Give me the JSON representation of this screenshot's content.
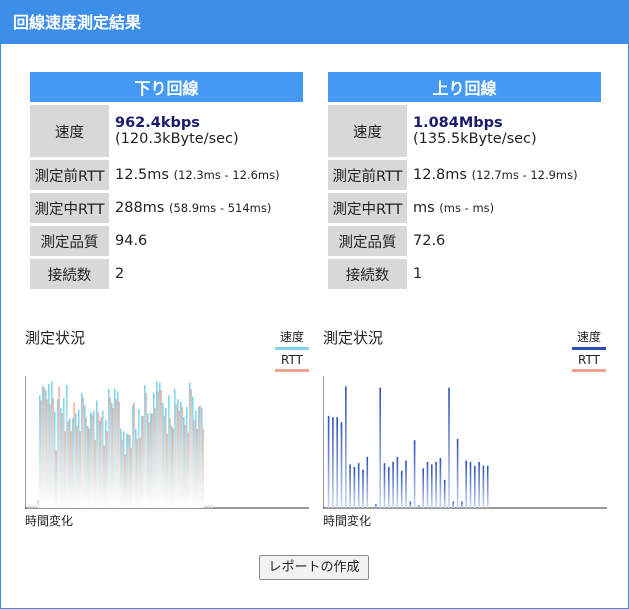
{
  "window": {
    "title": "回線速度測定結果"
  },
  "download": {
    "header": "下り回線",
    "speed_label": "速度",
    "speed_value": "962.4kbps",
    "speed_bytes": "(120.3kByte/sec)",
    "rtt_before_label": "測定前RTT",
    "rtt_before_value": "12.5ms",
    "rtt_before_range": "(12.3ms - 12.6ms)",
    "rtt_during_label": "測定中RTT",
    "rtt_during_value": "288ms",
    "rtt_during_range": "(58.9ms - 514ms)",
    "quality_label": "測定品質",
    "quality_value": "94.6",
    "connections_label": "接続数",
    "connections_value": "2"
  },
  "upload": {
    "header": "上り回線",
    "speed_label": "速度",
    "speed_value": "1.084Mbps",
    "speed_bytes": "(135.5kByte/sec)",
    "rtt_before_label": "測定前RTT",
    "rtt_before_value": "12.8ms",
    "rtt_before_range": "(12.7ms - 12.9ms)",
    "rtt_during_label": "測定中RTT",
    "rtt_during_value": "ms",
    "rtt_during_range": "(ms - ms)",
    "quality_label": "測定品質",
    "quality_value": "72.6",
    "connections_label": "接続数",
    "connections_value": "1"
  },
  "charts": {
    "download": {
      "title": "測定状況",
      "legend_speed": "速度",
      "legend_rtt": "RTT",
      "x_label": "時間変化",
      "speed_color": "#7fd3e8",
      "rtt_color": "#f0a290"
    },
    "upload": {
      "title": "測定状況",
      "legend_speed": "速度",
      "legend_rtt": "RTT",
      "x_label": "時間変化",
      "speed_color": "#2b50b8",
      "rtt_color": "#f0a290"
    }
  },
  "chart_data": [
    {
      "type": "bar",
      "title": "測定状況",
      "xlabel": "時間変化",
      "series": [
        {
          "name": "速度",
          "values": [
            0,
            0,
            0,
            0,
            0.88,
            0.95,
            0.92,
            0.97,
            0.99,
            0.75,
            0.85,
            0.78,
            0.86,
            0.96,
            0.7,
            0.7,
            0.74,
            0.77,
            0.9,
            0.8,
            0.64,
            0.75,
            0.76,
            0.84,
            0.68,
            0.76,
            0.69,
            0.93,
            0.82,
            0.93,
            0.91,
            0.62,
            0.6,
            0.58,
            0.57,
            0.8,
            0.62,
            0.77,
            0.72,
            0.96,
            0.74,
            0.74,
            0.9,
            0.99,
            0.98,
            0.82,
            0.78,
            0.88,
            0.64,
            0.93,
            0.85,
            0.83,
            0.71,
            0.79,
            0.98,
            0.87,
            0.76,
            0.79,
            0.78,
            0,
            0,
            0
          ]
        },
        {
          "name": "RTT",
          "values": [
            0.02,
            0.02,
            0.02,
            0.06,
            0.84,
            0.94,
            0.85,
            0.81,
            0.86,
            0.45,
            0.95,
            0.74,
            0.6,
            0.68,
            0.6,
            0.82,
            0.64,
            0.6,
            0.86,
            0.71,
            0.62,
            0.73,
            0.53,
            0.75,
            0.71,
            0.49,
            0.6,
            0.86,
            0.78,
            0.85,
            0.83,
            0.53,
            0.42,
            0.58,
            0.47,
            0.82,
            0.54,
            0.55,
            0.72,
            0.9,
            0.67,
            0.74,
            0.78,
            0.91,
            0.92,
            0.72,
            0.58,
            0.7,
            0.62,
            0.81,
            0.76,
            0.79,
            0.65,
            0.59,
            0.93,
            0.69,
            0.62,
            0.8,
            0.62,
            0.02,
            0.02,
            0.02
          ]
        }
      ]
    },
    {
      "type": "bar",
      "title": "測定状況",
      "xlabel": "時間変化",
      "series": [
        {
          "name": "速度",
          "values": [
            0,
            0.72,
            0.71,
            0.71,
            0.67,
            0.95,
            0.34,
            0.32,
            0.35,
            0.3,
            0.4,
            0,
            0.03,
            0.94,
            0.35,
            0.32,
            0.36,
            0.4,
            0.29,
            0.37,
            0.05,
            0.53,
            0.02,
            0.31,
            0.36,
            0.34,
            0.36,
            0.39,
            0.22,
            0.94,
            0.05,
            0.54,
            0.05,
            0.37,
            0.36,
            0.33,
            0.36,
            0.33,
            0.33
          ]
        },
        {
          "name": "RTT",
          "values": []
        }
      ]
    }
  ]
}
